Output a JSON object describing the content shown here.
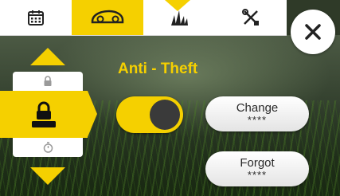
{
  "tabs": [
    {
      "icon": "calendar-icon",
      "active": false
    },
    {
      "icon": "robot-mower-icon",
      "active": true
    },
    {
      "icon": "grass-icon",
      "active": false
    },
    {
      "icon": "tools-icon",
      "active": false
    }
  ],
  "close_icon": "close-icon",
  "side_menu": {
    "items": [
      {
        "icon": "lock-icon",
        "selected": false
      },
      {
        "icon": "lock-pin-icon",
        "selected": true,
        "pin_mask": "****"
      },
      {
        "icon": "stopwatch-icon",
        "selected": false
      }
    ]
  },
  "main": {
    "title": "Anti - Theft",
    "toggle_on": true,
    "change": {
      "label": "Change",
      "mask": "****"
    },
    "forgot": {
      "label": "Forgot",
      "mask": "****"
    }
  },
  "colors": {
    "accent": "#f5d000",
    "knob": "#3a3a3a"
  }
}
